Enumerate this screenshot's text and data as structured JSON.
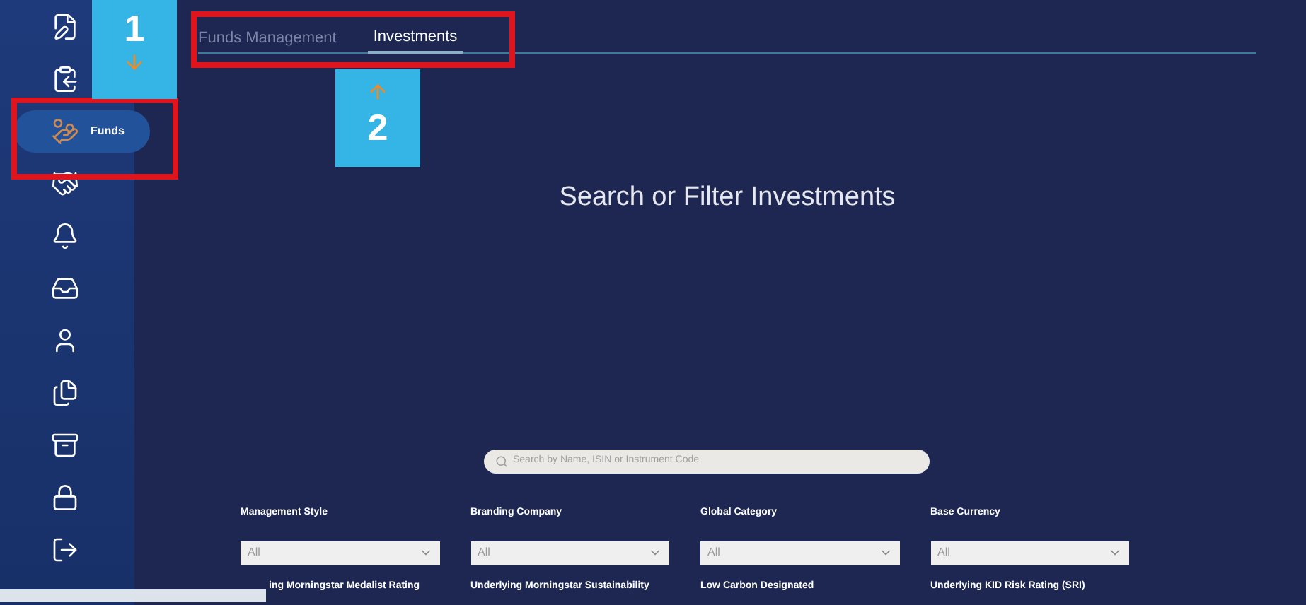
{
  "sidebar": {
    "items": [
      {
        "kind": "edit",
        "selected": false
      },
      {
        "kind": "clipboard",
        "selected": false
      },
      {
        "kind": "funds",
        "label": "Funds",
        "selected": true
      },
      {
        "kind": "handshake",
        "selected": false
      },
      {
        "kind": "bell",
        "selected": false
      },
      {
        "kind": "tray",
        "selected": false
      },
      {
        "kind": "user",
        "selected": false
      },
      {
        "kind": "files",
        "selected": false
      },
      {
        "kind": "archive",
        "selected": false
      },
      {
        "kind": "lock",
        "selected": false
      },
      {
        "kind": "logout",
        "selected": false
      }
    ]
  },
  "tabs": [
    {
      "label": "Funds Management",
      "selected": false
    },
    {
      "label": "Investments",
      "selected": true
    }
  ],
  "title": "Search or Filter Investments",
  "search": {
    "placeholder": "Search by Name, ISIN or Instrument Code"
  },
  "filters": [
    {
      "label": "Management Style",
      "value": "All"
    },
    {
      "label": "Branding Company",
      "value": "All"
    },
    {
      "label": "Global Category",
      "value": "All"
    },
    {
      "label": "Base Currency",
      "value": "All"
    }
  ],
  "filters_row_2": [
    "ing Morningstar Medalist Rating",
    "Underlying Morningstar Sustainability",
    "Low Carbon Designated",
    "Underlying KID Risk Rating (SRI)"
  ],
  "callouts": [
    {
      "number": "1"
    },
    {
      "number": "2"
    }
  ]
}
